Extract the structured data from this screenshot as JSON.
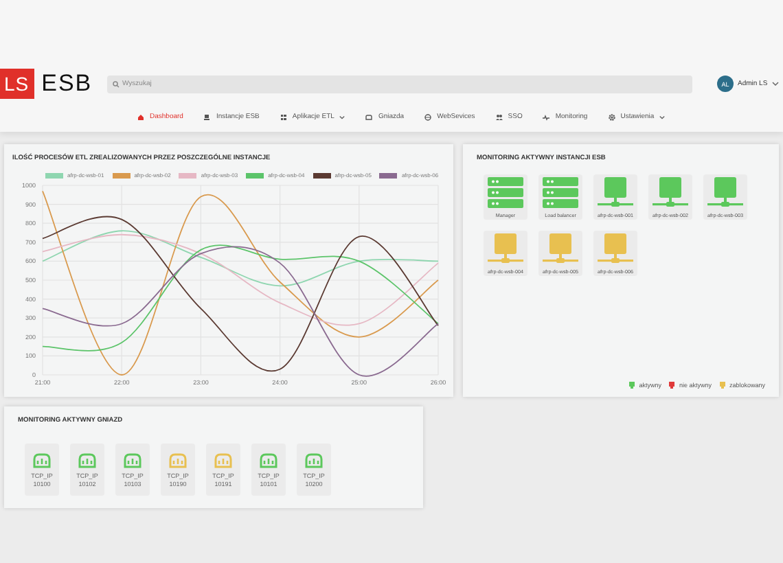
{
  "header": {
    "logo_mark": "LS",
    "logo_text": "ESB",
    "search": {
      "placeholder": "Wyszukaj"
    },
    "user": {
      "initials": "AL",
      "name": "Admin LS"
    }
  },
  "nav": [
    {
      "label": "Dashboard",
      "selected": true,
      "dropdown": false
    },
    {
      "label": "Instancje ESB",
      "selected": false,
      "dropdown": false
    },
    {
      "label": "Aplikacje ETL",
      "selected": false,
      "dropdown": true
    },
    {
      "label": "Gniazda",
      "selected": false,
      "dropdown": false
    },
    {
      "label": "WebSevices",
      "selected": false,
      "dropdown": false
    },
    {
      "label": "SSO",
      "selected": false,
      "dropdown": false
    },
    {
      "label": "Monitoring",
      "selected": false,
      "dropdown": false
    },
    {
      "label": "Ustawienia",
      "selected": false,
      "dropdown": true
    }
  ],
  "etl_panel": {
    "title": "ILOŚĆ PROCESÓW ETL ZREALIZOWANYCH PRZEZ POSZCZEGÓLNE INSTANCJE",
    "chart_data": {
      "type": "line",
      "grid": true,
      "categories": [
        "21:00",
        "22:00",
        "23:00",
        "24:00",
        "25:00",
        "26:00"
      ],
      "ylim": [
        0,
        1000
      ],
      "yticks": [
        0,
        100,
        200,
        300,
        400,
        500,
        600,
        700,
        800,
        900,
        1000
      ],
      "series": [
        {
          "name": "afrp-dc-wsb-01",
          "color": "#8fd6b0",
          "values": [
            600,
            760,
            620,
            470,
            600,
            600
          ]
        },
        {
          "name": "afrp-dc-wsb-02",
          "color": "#d99a4e",
          "values": [
            970,
            0,
            940,
            490,
            200,
            500
          ]
        },
        {
          "name": "afrp-dc-wsb-03",
          "color": "#e6b8c4",
          "values": [
            650,
            740,
            640,
            380,
            270,
            590
          ]
        },
        {
          "name": "afrp-dc-wsb-04",
          "color": "#5cc46a",
          "values": [
            150,
            170,
            660,
            610,
            600,
            270
          ]
        },
        {
          "name": "afrp-dc-wsb-05",
          "color": "#5b3a32",
          "values": [
            720,
            820,
            350,
            30,
            730,
            260
          ]
        },
        {
          "name": "afrp-dc-wsb-06",
          "color": "#8a6a90",
          "values": [
            350,
            270,
            640,
            590,
            0,
            270
          ]
        }
      ]
    }
  },
  "esb_panel": {
    "title": "MONITORING AKTYWNY INSTANCJI ESB",
    "instances": [
      {
        "label": "Manager",
        "kind": "server",
        "color": "#5cc85c"
      },
      {
        "label": "Load balancer",
        "kind": "server",
        "color": "#5cc85c"
      },
      {
        "label": "afrp-dc-wsb-001",
        "kind": "node",
        "color": "#5cc85c"
      },
      {
        "label": "afrp-dc-wsb-002",
        "kind": "node",
        "color": "#5cc85c"
      },
      {
        "label": "afrp-dc-wsb-003",
        "kind": "node",
        "color": "#5cc85c"
      },
      {
        "label": "afrp-dc-wsb-004",
        "kind": "node",
        "color": "#e8c050"
      },
      {
        "label": "afrp-dc-wsb-005",
        "kind": "node",
        "color": "#e8c050"
      },
      {
        "label": "afrp-dc-wsb-006",
        "kind": "node",
        "color": "#e8c050"
      }
    ],
    "legend": [
      {
        "label": "aktywny",
        "color": "#5cc85c"
      },
      {
        "label": "nie aktywny",
        "color": "#e03a3a"
      },
      {
        "label": "zablokowany",
        "color": "#e8c050"
      }
    ]
  },
  "gateway_panel": {
    "title": "MONITORING AKTYWNY GNIAZD",
    "gateways": [
      {
        "label": "TCP_IP",
        "port": "10100",
        "color": "#5cc85c"
      },
      {
        "label": "TCP_IP",
        "port": "10102",
        "color": "#5cc85c"
      },
      {
        "label": "TCP_IP",
        "port": "10103",
        "color": "#5cc85c"
      },
      {
        "label": "TCP_IP",
        "port": "10190",
        "color": "#e8c050"
      },
      {
        "label": "TCP_IP",
        "port": "10191",
        "color": "#e8c050"
      },
      {
        "label": "TCP_IP",
        "port": "10101",
        "color": "#5cc85c"
      },
      {
        "label": "TCP_IP",
        "port": "10200",
        "color": "#5cc85c"
      }
    ]
  }
}
